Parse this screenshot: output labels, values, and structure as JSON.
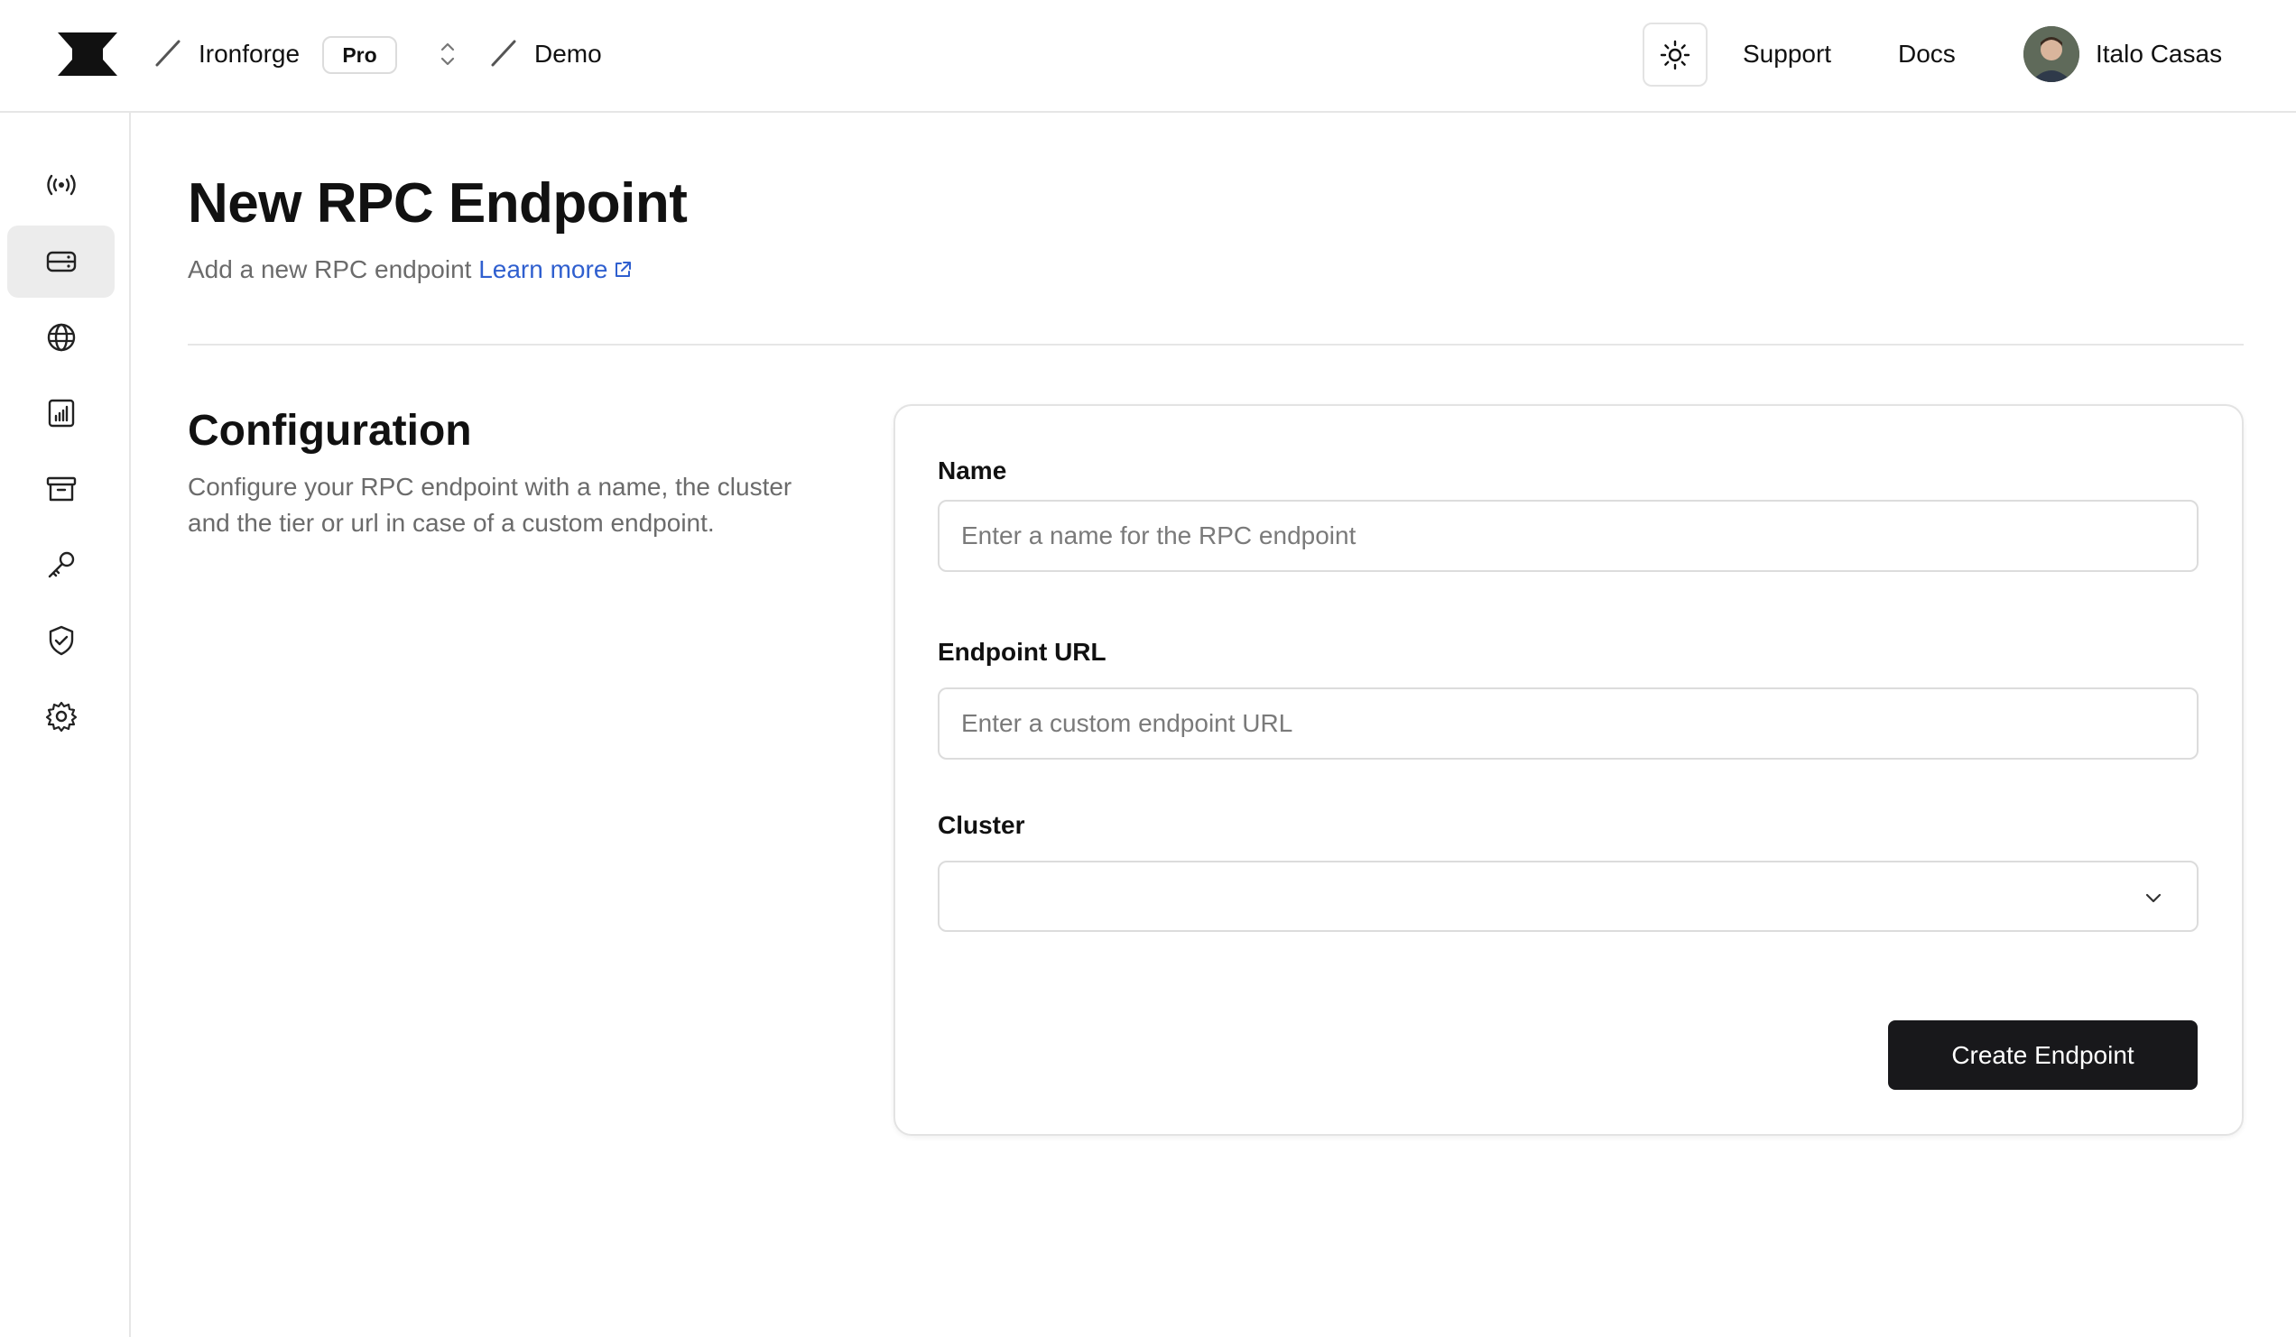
{
  "header": {
    "org_name": "Ironforge",
    "plan_badge": "Pro",
    "project_name": "Demo",
    "links": {
      "support": "Support",
      "docs": "Docs"
    },
    "user_name": "Italo Casas"
  },
  "sidebar": {
    "items": [
      {
        "icon": "broadcast-icon",
        "active": false
      },
      {
        "icon": "server-icon",
        "active": true
      },
      {
        "icon": "globe-icon",
        "active": false
      },
      {
        "icon": "analytics-icon",
        "active": false
      },
      {
        "icon": "archive-icon",
        "active": false
      },
      {
        "icon": "key-icon",
        "active": false
      },
      {
        "icon": "shield-check-icon",
        "active": false
      },
      {
        "icon": "gear-icon",
        "active": false
      }
    ]
  },
  "main": {
    "title": "New RPC Endpoint",
    "subtitle": "Add a new RPC endpoint",
    "learn_more": "Learn more"
  },
  "configuration": {
    "title": "Configuration",
    "description": "Configure your RPC endpoint with a name, the cluster and the tier or url in case of a custom endpoint."
  },
  "form": {
    "name_label": "Name",
    "name_placeholder": "Enter a name for the RPC endpoint",
    "name_value": "",
    "url_label": "Endpoint URL",
    "url_placeholder": "Enter a custom endpoint URL",
    "url_value": "",
    "cluster_label": "Cluster",
    "cluster_value": "",
    "submit_label": "Create Endpoint"
  },
  "colors": {
    "accent_link": "#2f5fcf",
    "primary_button": "#18181b",
    "active_nav_bg": "#ececec"
  }
}
